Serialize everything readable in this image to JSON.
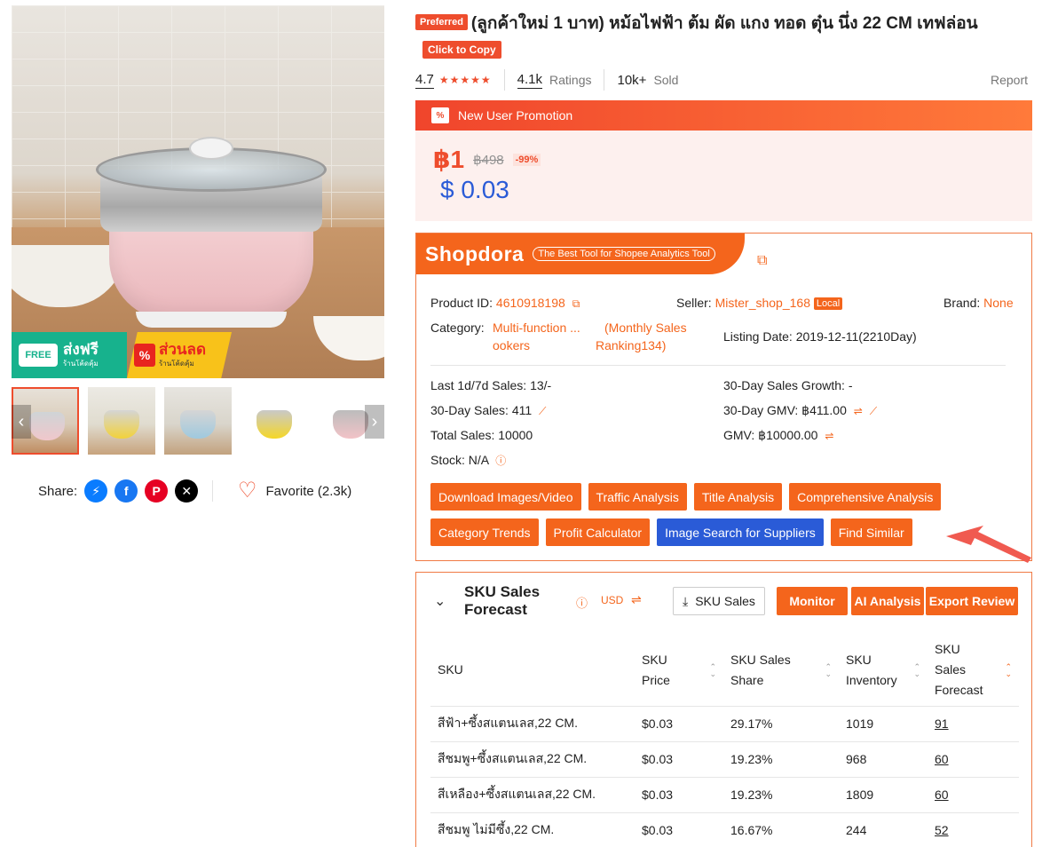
{
  "product": {
    "badge": "Preferred",
    "title": "(ลูกค้าใหม่ 1 บาท) หม้อไฟฟ้า ต้ม ผัด แกง ทอด ตุ๋น นึ่ง 22 CM เทฟล่อน",
    "copy_label": "Click to Copy",
    "rating": "4.7",
    "ratings_count": "4.1k",
    "ratings_label": "Ratings",
    "sold_count": "10k+",
    "sold_label": "Sold",
    "report_label": "Report",
    "promo_label": "New User Promotion",
    "price_now": "฿1",
    "price_old": "฿498",
    "discount": "-99%",
    "price_usd": "$ 0.03"
  },
  "image": {
    "free_title": "ส่งฟรี",
    "free_sub": "ร้านโค้ดคุ้ม",
    "free_word": "FREE",
    "disc_title": "ส่วนลด",
    "disc_sub": "ร้านโค้ดคุ้ม",
    "disc_symbol": "%"
  },
  "share": {
    "label": "Share:",
    "favorite_label": "Favorite (2.3k)"
  },
  "shopdora": {
    "logo": "Shopdora",
    "tagline": "The Best Tool for Shopee Analytics Tool",
    "product_id_label": "Product ID:",
    "product_id": "4610918198",
    "seller_label": "Seller:",
    "seller": "Mister_shop_168",
    "local_tag": "Local",
    "brand_label": "Brand:",
    "brand": "None",
    "category_label": "Category:",
    "category_line1": "Multi-function ...",
    "category_line2": "ookers",
    "ranking_line1": "(Monthly Sales",
    "ranking_line2": "Ranking134)",
    "listing_label": "Listing Date:",
    "listing_value": "2019-12-11(2210Day)",
    "sales_1d7d_label": "Last 1d/7d Sales:",
    "sales_1d7d": "13/-",
    "growth_label": "30-Day Sales Growth:",
    "growth": "-",
    "sales30_label": "30-Day Sales:",
    "sales30": "411",
    "gmv30_label": "30-Day GMV:",
    "gmv30": "฿411.00",
    "total_sales_label": "Total Sales:",
    "total_sales": "10000",
    "gmv_label": "GMV:",
    "gmv": "฿10000.00",
    "stock_label": "Stock:",
    "stock": "N/A",
    "buttons_row1": [
      "Download Images/Video",
      "Traffic Analysis",
      "Title Analysis",
      "Comprehensive Analysis"
    ],
    "buttons_row2": [
      "Category Trends",
      "Profit Calculator",
      "Image Search for Suppliers",
      "Find Similar"
    ]
  },
  "sku": {
    "title_line1": "SKU Sales",
    "title_line2": "Forecast",
    "currency": "USD",
    "sku_sales_btn": "SKU Sales",
    "monitor_btn": "Monitor",
    "ai_btn": "AI Analysis",
    "export_btn": "Export Review",
    "headers": [
      "SKU",
      "SKU Price",
      "SKU Sales Share",
      "SKU Inventory",
      "SKU Sales Forecast"
    ],
    "rows": [
      [
        "สีฟ้า+ซึ้งสแตนเลส,22 CM.",
        "$0.03",
        "29.17%",
        "1019",
        "91"
      ],
      [
        "สีชมพู+ซึ้งสแตนเลส,22 CM.",
        "$0.03",
        "19.23%",
        "968",
        "60"
      ],
      [
        "สีเหลือง+ซึ้งสแตนเลส,22 CM.",
        "$0.03",
        "19.23%",
        "1809",
        "60"
      ],
      [
        "สีชมพู ไม่มีซึ้ง,22 CM.",
        "$0.03",
        "16.67%",
        "244",
        "52"
      ]
    ]
  },
  "colors": {
    "shopee_orange": "#ee4d2d",
    "shopdora_orange": "#f4651c",
    "blue_button": "#2a5bd7"
  }
}
